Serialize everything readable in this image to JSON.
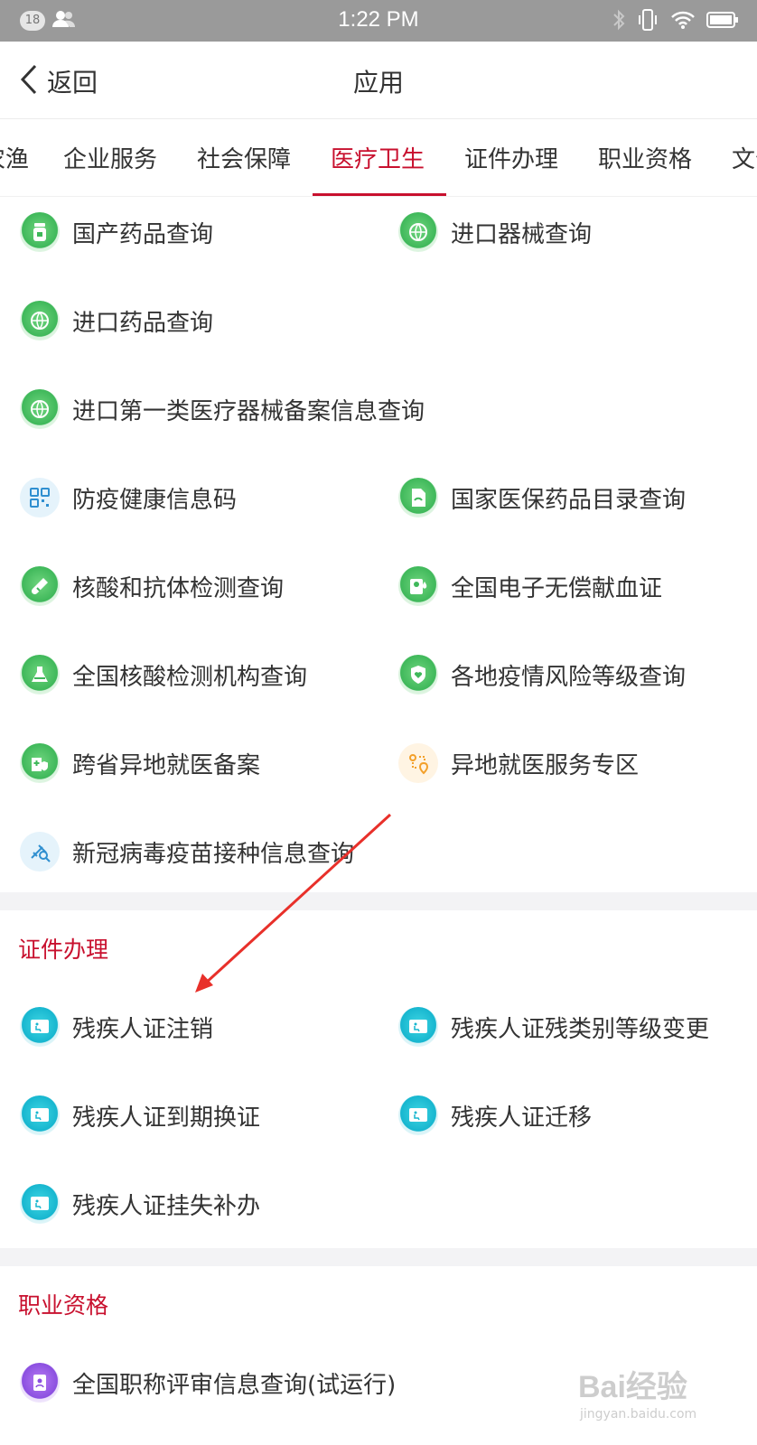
{
  "status_bar": {
    "badge": "18",
    "time": "1:22 PM"
  },
  "nav": {
    "back_label": "返回",
    "title": "应用"
  },
  "tabs": [
    {
      "label": "农渔",
      "active": false
    },
    {
      "label": "企业服务",
      "active": false
    },
    {
      "label": "社会保障",
      "active": false
    },
    {
      "label": "医疗卫生",
      "active": true
    },
    {
      "label": "证件办理",
      "active": false
    },
    {
      "label": "职业资格",
      "active": false
    },
    {
      "label": "文化",
      "active": false
    }
  ],
  "medical": {
    "items": [
      {
        "label": "国产药品查询",
        "icon": "pill-bottle-icon"
      },
      {
        "label": "进口器械查询",
        "icon": "globe-device-icon"
      },
      {
        "label": "进口药品查询",
        "icon": "globe-pill-icon"
      },
      {
        "label": "进口第一类医疗器械备案信息查询",
        "icon": "globe-gear-icon"
      },
      {
        "label": "防疫健康信息码",
        "icon": "qr-code-icon"
      },
      {
        "label": "国家医保药品目录查询",
        "icon": "document-icon"
      },
      {
        "label": "核酸和抗体检测查询",
        "icon": "test-tube-icon"
      },
      {
        "label": "全国电子无偿献血证",
        "icon": "blood-card-icon"
      },
      {
        "label": "全国核酸检测机构查询",
        "icon": "flask-icon"
      },
      {
        "label": "各地疫情风险等级查询",
        "icon": "shield-heart-icon"
      },
      {
        "label": "跨省异地就医备案",
        "icon": "hospital-shield-icon"
      },
      {
        "label": "异地就医服务专区",
        "icon": "location-route-icon"
      },
      {
        "label": "新冠病毒疫苗接种信息查询",
        "icon": "syringe-search-icon"
      }
    ]
  },
  "certificates": {
    "title": "证件办理",
    "items": [
      {
        "label": "残疾人证注销",
        "icon": "disability-card-icon"
      },
      {
        "label": "残疾人证残类别等级变更",
        "icon": "disability-card-icon"
      },
      {
        "label": "残疾人证到期换证",
        "icon": "disability-card-icon"
      },
      {
        "label": "残疾人证迁移",
        "icon": "disability-card-icon"
      },
      {
        "label": "残疾人证挂失补办",
        "icon": "disability-card-icon"
      }
    ]
  },
  "qualifications": {
    "title": "职业资格",
    "items": [
      {
        "label": "全国职称评审信息查询(试运行)",
        "icon": "id-badge-icon"
      }
    ]
  },
  "watermark": {
    "brand": "Bai经验",
    "url": "jingyan.baidu.com"
  },
  "colors": {
    "accent": "#c8102e",
    "green": "#3fb85a",
    "teal": "#17b6cf",
    "purple": "#8b4fe0"
  }
}
